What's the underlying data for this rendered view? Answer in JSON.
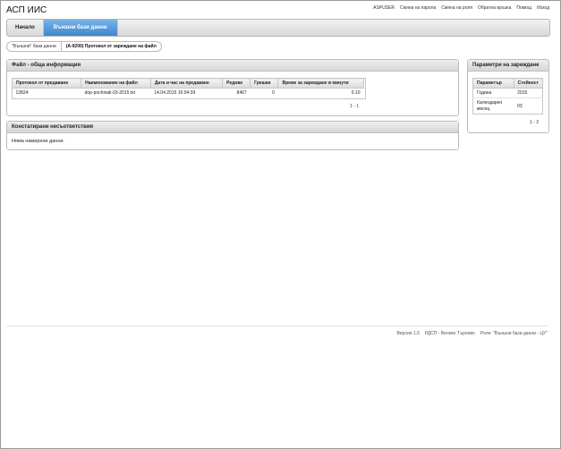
{
  "app": {
    "title": "АСП ИИС"
  },
  "top_links": [
    "ASPUSER",
    "Смяна на парола",
    "Смяна на роля",
    "Обратна връзка",
    "Помощ",
    "Изход"
  ],
  "nav": {
    "home": "Начало",
    "external_db": "Външни бази данни"
  },
  "breadcrumb": {
    "first": "\"Външни\" бази данни",
    "second": "(A-9200) Протокол от зареждане на файл"
  },
  "file_panel": {
    "title": "Файл - обща информация",
    "columns": [
      "Протокол от предаване",
      "Наименование на файл",
      "Дата и час на предаване",
      "Редове",
      "Грешки",
      "Време за зареждане в минути"
    ],
    "rows": [
      [
        "12824",
        "dop-pochinali-03-2015.txt",
        "14.04.2015 16:04:39",
        "8467",
        "0",
        "0.10"
      ]
    ],
    "pager": "1 - 1"
  },
  "issues_panel": {
    "title": "Констатирани несъответствия",
    "empty": "Няма намерени данни."
  },
  "params_panel": {
    "title": "Параметри на зареждане",
    "columns": [
      "Параметър",
      "Стойност"
    ],
    "rows": [
      [
        "Година",
        "2015"
      ],
      [
        "Календарен месец",
        "03"
      ]
    ],
    "pager": "1 - 2"
  },
  "footer": {
    "version": "Версия 1.0",
    "office": "РДСП - Велико Търново",
    "role": "Роля: \"Външни бази данни - ЦУ\""
  }
}
